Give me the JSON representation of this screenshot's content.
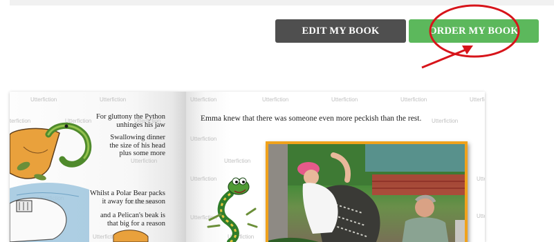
{
  "actions": {
    "edit_label": "EDIT MY BOOK",
    "order_label": "ORDER MY BOOK"
  },
  "annotation": {
    "circle_color": "#d7141a",
    "arrow_color": "#d7141a"
  },
  "colors": {
    "edit_button": "#4f4f4f",
    "order_button": "#5cb85c",
    "photo_frame": "#f0a21c"
  },
  "watermark": "Utterfiction",
  "book": {
    "left_page": {
      "stanzas": [
        "For gluttony the Python",
        "unhinges his jaw",
        "Swallowing dinner",
        "the size of his head",
        "plus some more",
        "Whilst a Polar Bear packs",
        "it away for the season",
        "and a Pelican's beak is",
        "that big for a reason"
      ],
      "illustration": "pelican-python-illustration"
    },
    "right_page": {
      "story_line": "Emma knew that there was someone even more peckish than the rest.",
      "illustration": "snake-cartoon",
      "photo": "family-photo"
    }
  }
}
